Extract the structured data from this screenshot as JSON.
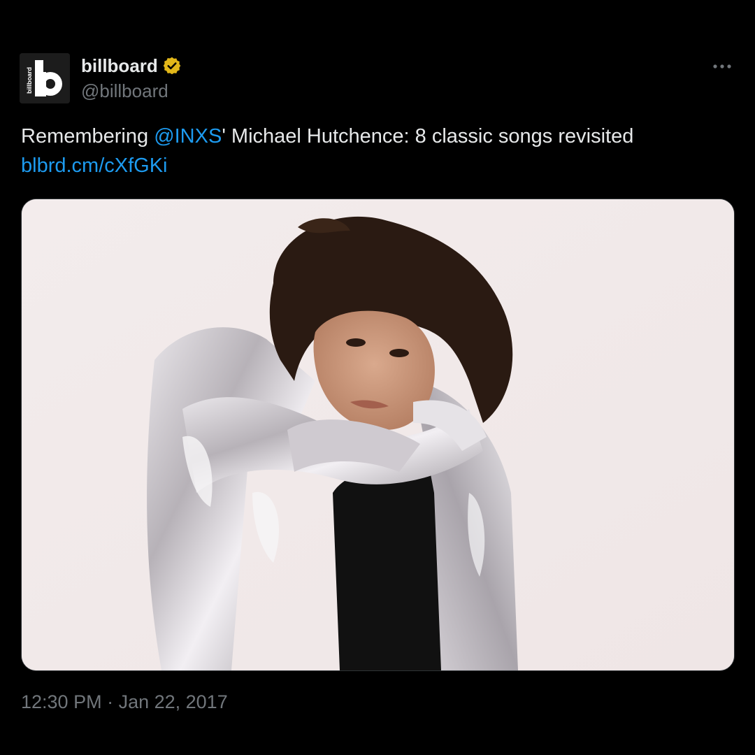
{
  "author": {
    "display_name": "billboard",
    "handle": "@billboard",
    "avatar_letter": "b",
    "avatar_wordmark": "billboard",
    "verified": true,
    "verified_color": "#e2b719"
  },
  "tweet": {
    "text_prefix": "Remembering ",
    "mention": "@INXS",
    "text_suffix": "' Michael Hutchence: 8 classic songs revisited",
    "link": "blbrd.cm/cXfGKi",
    "link_color": "#1d9bf0"
  },
  "meta": {
    "time": "12:30 PM",
    "separator": " · ",
    "date": "Jan 22, 2017"
  },
  "icons": {
    "more": "more-horizontal-icon",
    "verified": "verified-badge-icon"
  },
  "colors": {
    "background": "#000000",
    "text_primary": "#e7e9ea",
    "text_secondary": "#71767b",
    "accent": "#1d9bf0"
  }
}
